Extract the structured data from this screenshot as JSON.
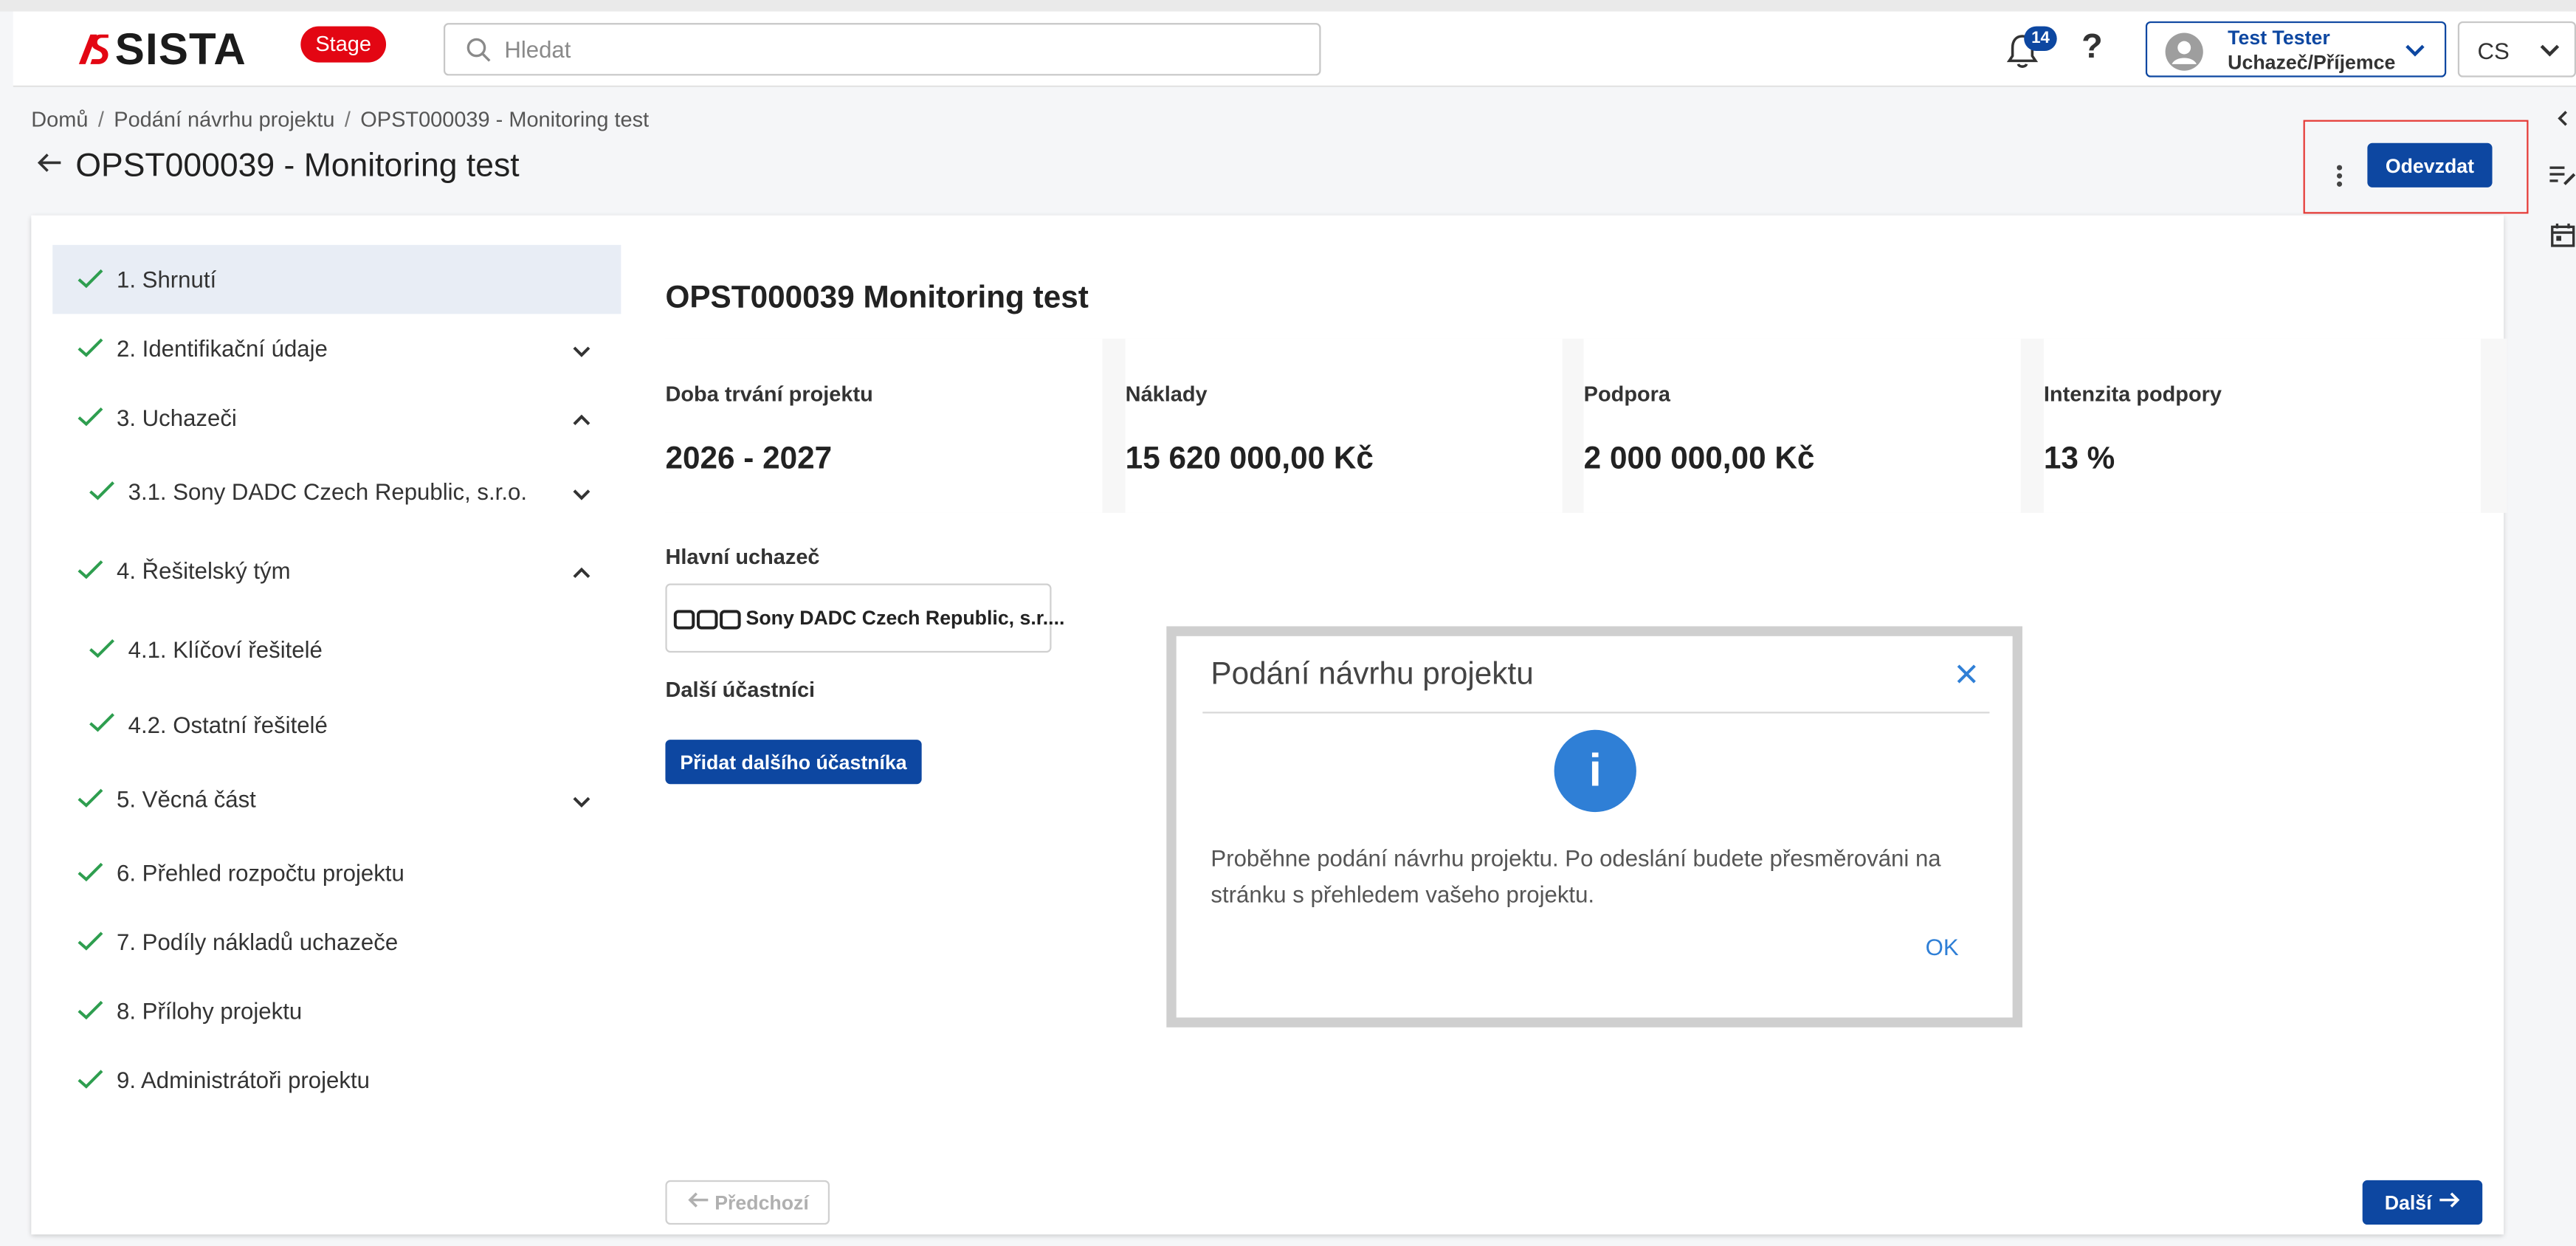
{
  "header": {
    "logo_text": "SISTA",
    "env_badge": "Stage",
    "search_placeholder": "Hledat",
    "notifications_count": "14",
    "help_label": "?",
    "user_name": "Test Tester",
    "user_role": "Uchazeč/Příjemce",
    "language": "CS"
  },
  "breadcrumb": {
    "items": [
      "Domů",
      "Podání návrhu projektu",
      "OPST000039 - Monitoring test"
    ]
  },
  "page": {
    "title": "OPST000039 - Monitoring test",
    "submit_label": "Odevzdat"
  },
  "steps": [
    {
      "label": "1.  Shrnutí"
    },
    {
      "label": "2.  Identifikační údaje"
    },
    {
      "label": "3.  Uchazeči"
    },
    {
      "label": "3.1.  Sony DADC Czech Republic, s.r.o."
    },
    {
      "label": "4.  Řešitelský tým"
    },
    {
      "label": "4.1.  Klíčoví řešitelé"
    },
    {
      "label": "4.2.  Ostatní řešitelé"
    },
    {
      "label": "5.  Věcná část"
    },
    {
      "label": "6.  Přehled rozpočtu projektu"
    },
    {
      "label": "7.  Podíly nákladů uchazeče"
    },
    {
      "label": "8.  Přílohy projektu"
    },
    {
      "label": "9.  Administrátoři projektu"
    }
  ],
  "summary": {
    "title": "OPST000039 Monitoring test",
    "stats": [
      {
        "label": "Doba trvání projektu",
        "value": "2026 - 2027"
      },
      {
        "label": "Náklady",
        "value": "15 620 000,00 Kč"
      },
      {
        "label": "Podpora",
        "value": "2 000 000,00 Kč"
      },
      {
        "label": "Intenzita podpory",
        "value": "13 %"
      }
    ],
    "main_applicant_label": "Hlavní uchazeč",
    "main_applicant_name": "Sony DADC Czech Republic, s.r....",
    "other_participants_label": "Další účastníci",
    "add_participant_label": "Přidat dalšího účastníka"
  },
  "nav": {
    "prev_label": "Předchozí",
    "next_label": "Další"
  },
  "dialog": {
    "title": "Podání návrhu projektu",
    "icon": "i",
    "message": "Proběhne podání návrhu projektu. Po odeslání budete přesměrováni na stránku s přehledem vašeho projektu.",
    "ok_label": "OK"
  },
  "colors": {
    "primary": "#0d47a1",
    "badge": "#e30613",
    "check": "#2e9e4f",
    "info": "#2f7fd6"
  }
}
